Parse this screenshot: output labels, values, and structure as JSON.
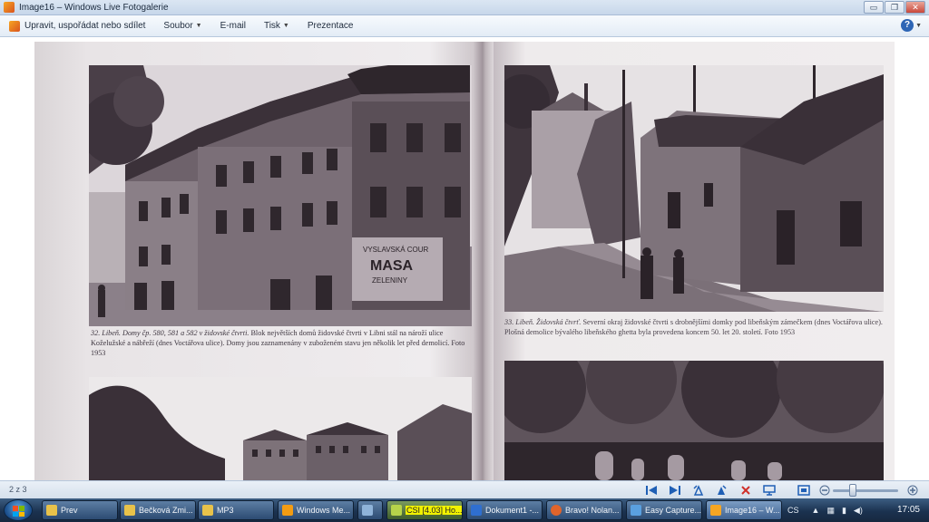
{
  "window": {
    "title": "Image16 – Windows Live Fotogalerie",
    "controls": [
      "▭",
      "❐",
      "✕"
    ]
  },
  "menubar": {
    "items": [
      {
        "label": "Upravit, uspořádat nebo sdílet",
        "has_arrow": false
      },
      {
        "label": "Soubor",
        "has_arrow": true
      },
      {
        "label": "E-mail",
        "has_arrow": false
      },
      {
        "label": "Tisk",
        "has_arrow": true
      },
      {
        "label": "Prezentace",
        "has_arrow": false
      }
    ],
    "help_label": "?"
  },
  "book": {
    "caption_left_lead": "32. Libeň. Domy čp. 580, 581 a 582 v židovské čtvrti.",
    "caption_left_body": "Blok největších domů židovské čtvrti v Libni stál na nároží ulice Koželužské a nábřeží (dnes Voctářova ulice). Domy jsou zaznamenány v zuboženém stavu jen několik let před demolicí. Foto 1953",
    "caption_right_lead": "33. Libeň. Židovská čtvrť.",
    "caption_right_body": "Severní okraj židovské čtvrti s drobnějšími domky pod libeňským zámečkem (dnes Voctářova ulice). Plošná demolice bývalého libeňského ghetta byla provedena koncem 50. let 20. století. Foto 1953",
    "wall_sign_line1": "VYSLAVSKÁ COUR",
    "wall_sign_line2": "MASA",
    "wall_sign_line3": "ZELENINY"
  },
  "viewer_controls": {
    "counter": "2 z 3",
    "icons": [
      "previous-icon",
      "next-icon",
      "rotate-left-icon",
      "rotate-right-icon",
      "delete-icon",
      "slideshow-icon",
      "fit-icon",
      "zoom-out-icon",
      "zoom-in-icon"
    ],
    "zoom_level": 0.3
  },
  "taskbar": {
    "items": [
      {
        "label": "Prev",
        "color": "#e8c24a"
      },
      {
        "label": "Bečková Zmi...",
        "color": "#e8c24a"
      },
      {
        "label": "MP3",
        "color": "#e8c24a"
      },
      {
        "label": "Windows Me...",
        "color": "#f39c12"
      },
      {
        "label": "",
        "color": "#8fb3d9"
      },
      {
        "label": "CSI [4.03] Ho...",
        "color": "#b6d34a",
        "highlight": true
      },
      {
        "label": "Dokument1 -...",
        "color": "#2f6fd0"
      },
      {
        "label": "Bravo! Nolan...",
        "color": "#e0642a"
      },
      {
        "label": "Easy Capture...",
        "color": "#5aa0e0"
      },
      {
        "label": "Image16 – W...",
        "color": "#f6a623"
      }
    ],
    "language": "CS",
    "clock": "17:05"
  }
}
